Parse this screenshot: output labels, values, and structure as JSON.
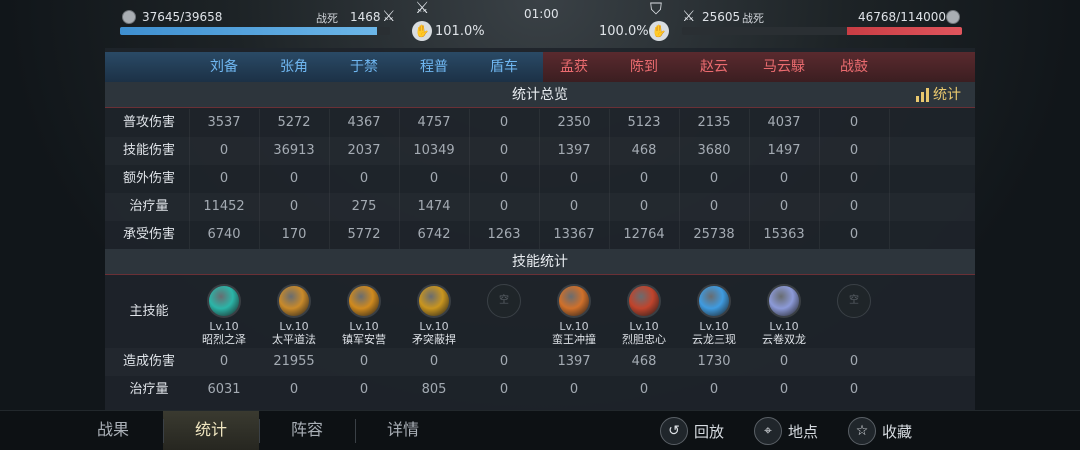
{
  "top": {
    "left_hp": "37645/39658",
    "left_hp_fraction": 0.95,
    "left_dead_label": "战死",
    "left_dead_value": "1468",
    "left_morale": "101.0%",
    "timer": "01:00",
    "right_morale": "100.0%",
    "right_dead_value": "25605",
    "right_dead_label": "战死",
    "right_hp": "46768/114000",
    "right_hp_fraction": 0.41
  },
  "heroes": [
    "刘备",
    "张角",
    "于禁",
    "程普",
    "盾车",
    "孟获",
    "陈到",
    "赵云",
    "马云騄",
    "战鼓"
  ],
  "overview": {
    "title": "统计总览",
    "stat_button": "统计",
    "rows": [
      {
        "label": "普攻伤害",
        "values": [
          "3537",
          "5272",
          "4367",
          "4757",
          "0",
          "2350",
          "5123",
          "2135",
          "4037",
          "0"
        ]
      },
      {
        "label": "技能伤害",
        "values": [
          "0",
          "36913",
          "2037",
          "10349",
          "0",
          "1397",
          "468",
          "3680",
          "1497",
          "0"
        ]
      },
      {
        "label": "额外伤害",
        "values": [
          "0",
          "0",
          "0",
          "0",
          "0",
          "0",
          "0",
          "0",
          "0",
          "0"
        ]
      },
      {
        "label": "治疗量",
        "values": [
          "11452",
          "0",
          "275",
          "1474",
          "0",
          "0",
          "0",
          "0",
          "0",
          "0"
        ]
      },
      {
        "label": "承受伤害",
        "values": [
          "6740",
          "170",
          "5772",
          "6742",
          "1263",
          "13367",
          "12764",
          "25738",
          "15363",
          "0"
        ]
      }
    ]
  },
  "skills": {
    "title": "技能统计",
    "main_label": "主技能",
    "empty_label": "空",
    "items": [
      {
        "lv": "Lv.10",
        "name": "昭烈之泽",
        "color": "#2bb5a8",
        "empty": false
      },
      {
        "lv": "Lv.10",
        "name": "太平道法",
        "color": "#c98a2a",
        "empty": false
      },
      {
        "lv": "Lv.10",
        "name": "镇军安营",
        "color": "#d08a1e",
        "empty": false
      },
      {
        "lv": "Lv.10",
        "name": "矛突蔽捍",
        "color": "#c9951f",
        "empty": false
      },
      {
        "lv": "",
        "name": "",
        "color": "",
        "empty": true
      },
      {
        "lv": "Lv.10",
        "name": "蛮王冲撞",
        "color": "#d0702a",
        "empty": false
      },
      {
        "lv": "Lv.10",
        "name": "烈胆忠心",
        "color": "#c0442c",
        "empty": false
      },
      {
        "lv": "Lv.10",
        "name": "云龙三现",
        "color": "#3f9be0",
        "empty": false
      },
      {
        "lv": "Lv.10",
        "name": "云卷双龙",
        "color": "#8c9ad8",
        "empty": false
      },
      {
        "lv": "",
        "name": "",
        "color": "",
        "empty": true
      }
    ],
    "rows": [
      {
        "label": "造成伤害",
        "values": [
          "0",
          "21955",
          "0",
          "0",
          "0",
          "1397",
          "468",
          "1730",
          "0",
          "0"
        ]
      },
      {
        "label": "治疗量",
        "values": [
          "6031",
          "0",
          "0",
          "805",
          "0",
          "0",
          "0",
          "0",
          "0",
          "0"
        ]
      }
    ]
  },
  "nav": {
    "tabs": [
      "战果",
      "统计",
      "阵容",
      "详情"
    ],
    "active_index": 1,
    "actions": [
      {
        "label": "回放",
        "icon": "replay-icon",
        "glyph": "↺"
      },
      {
        "label": "地点",
        "icon": "location-icon",
        "glyph": "⌖"
      },
      {
        "label": "收藏",
        "icon": "star-icon",
        "glyph": "☆"
      }
    ]
  },
  "colors": {
    "blue_team": "#6fb6f0",
    "red_team": "#ea6b6f",
    "accent": "#e9c86e"
  }
}
